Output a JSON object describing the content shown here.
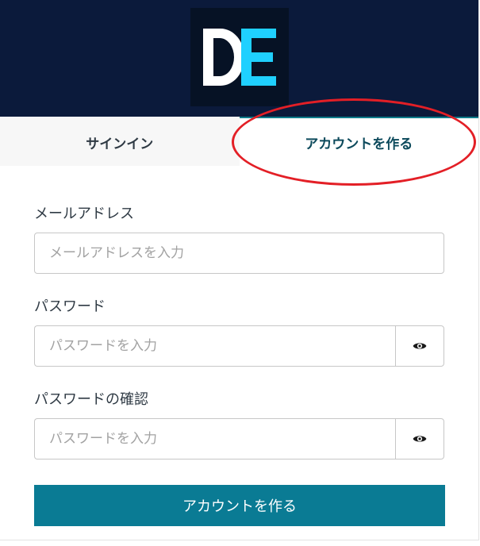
{
  "logo": {
    "text": "DE",
    "name": "de-logo",
    "colors": {
      "d": "#ffffff",
      "e": "#1fd0ff"
    }
  },
  "tabs": [
    {
      "label": "サインイン",
      "active": false
    },
    {
      "label": "アカウントを作る",
      "active": true
    }
  ],
  "annotation": {
    "type": "red-ellipse",
    "target": "tab-create-account",
    "color": "#e31f26"
  },
  "form": {
    "email": {
      "label": "メールアドレス",
      "placeholder": "メールアドレスを入力",
      "value": ""
    },
    "password": {
      "label": "パスワード",
      "placeholder": "パスワードを入力",
      "value": "",
      "toggle_icon": "eye-icon"
    },
    "confirm_password": {
      "label": "パスワードの確認",
      "placeholder": "パスワードを入力",
      "value": "",
      "toggle_icon": "eye-icon"
    },
    "submit_label": "アカウントを作る"
  },
  "colors": {
    "header_bg": "#0b1a3b",
    "accent": "#0a7b94",
    "tab_active_text": "#0d4a5c",
    "tab_active_border": "#0e7c8c"
  }
}
